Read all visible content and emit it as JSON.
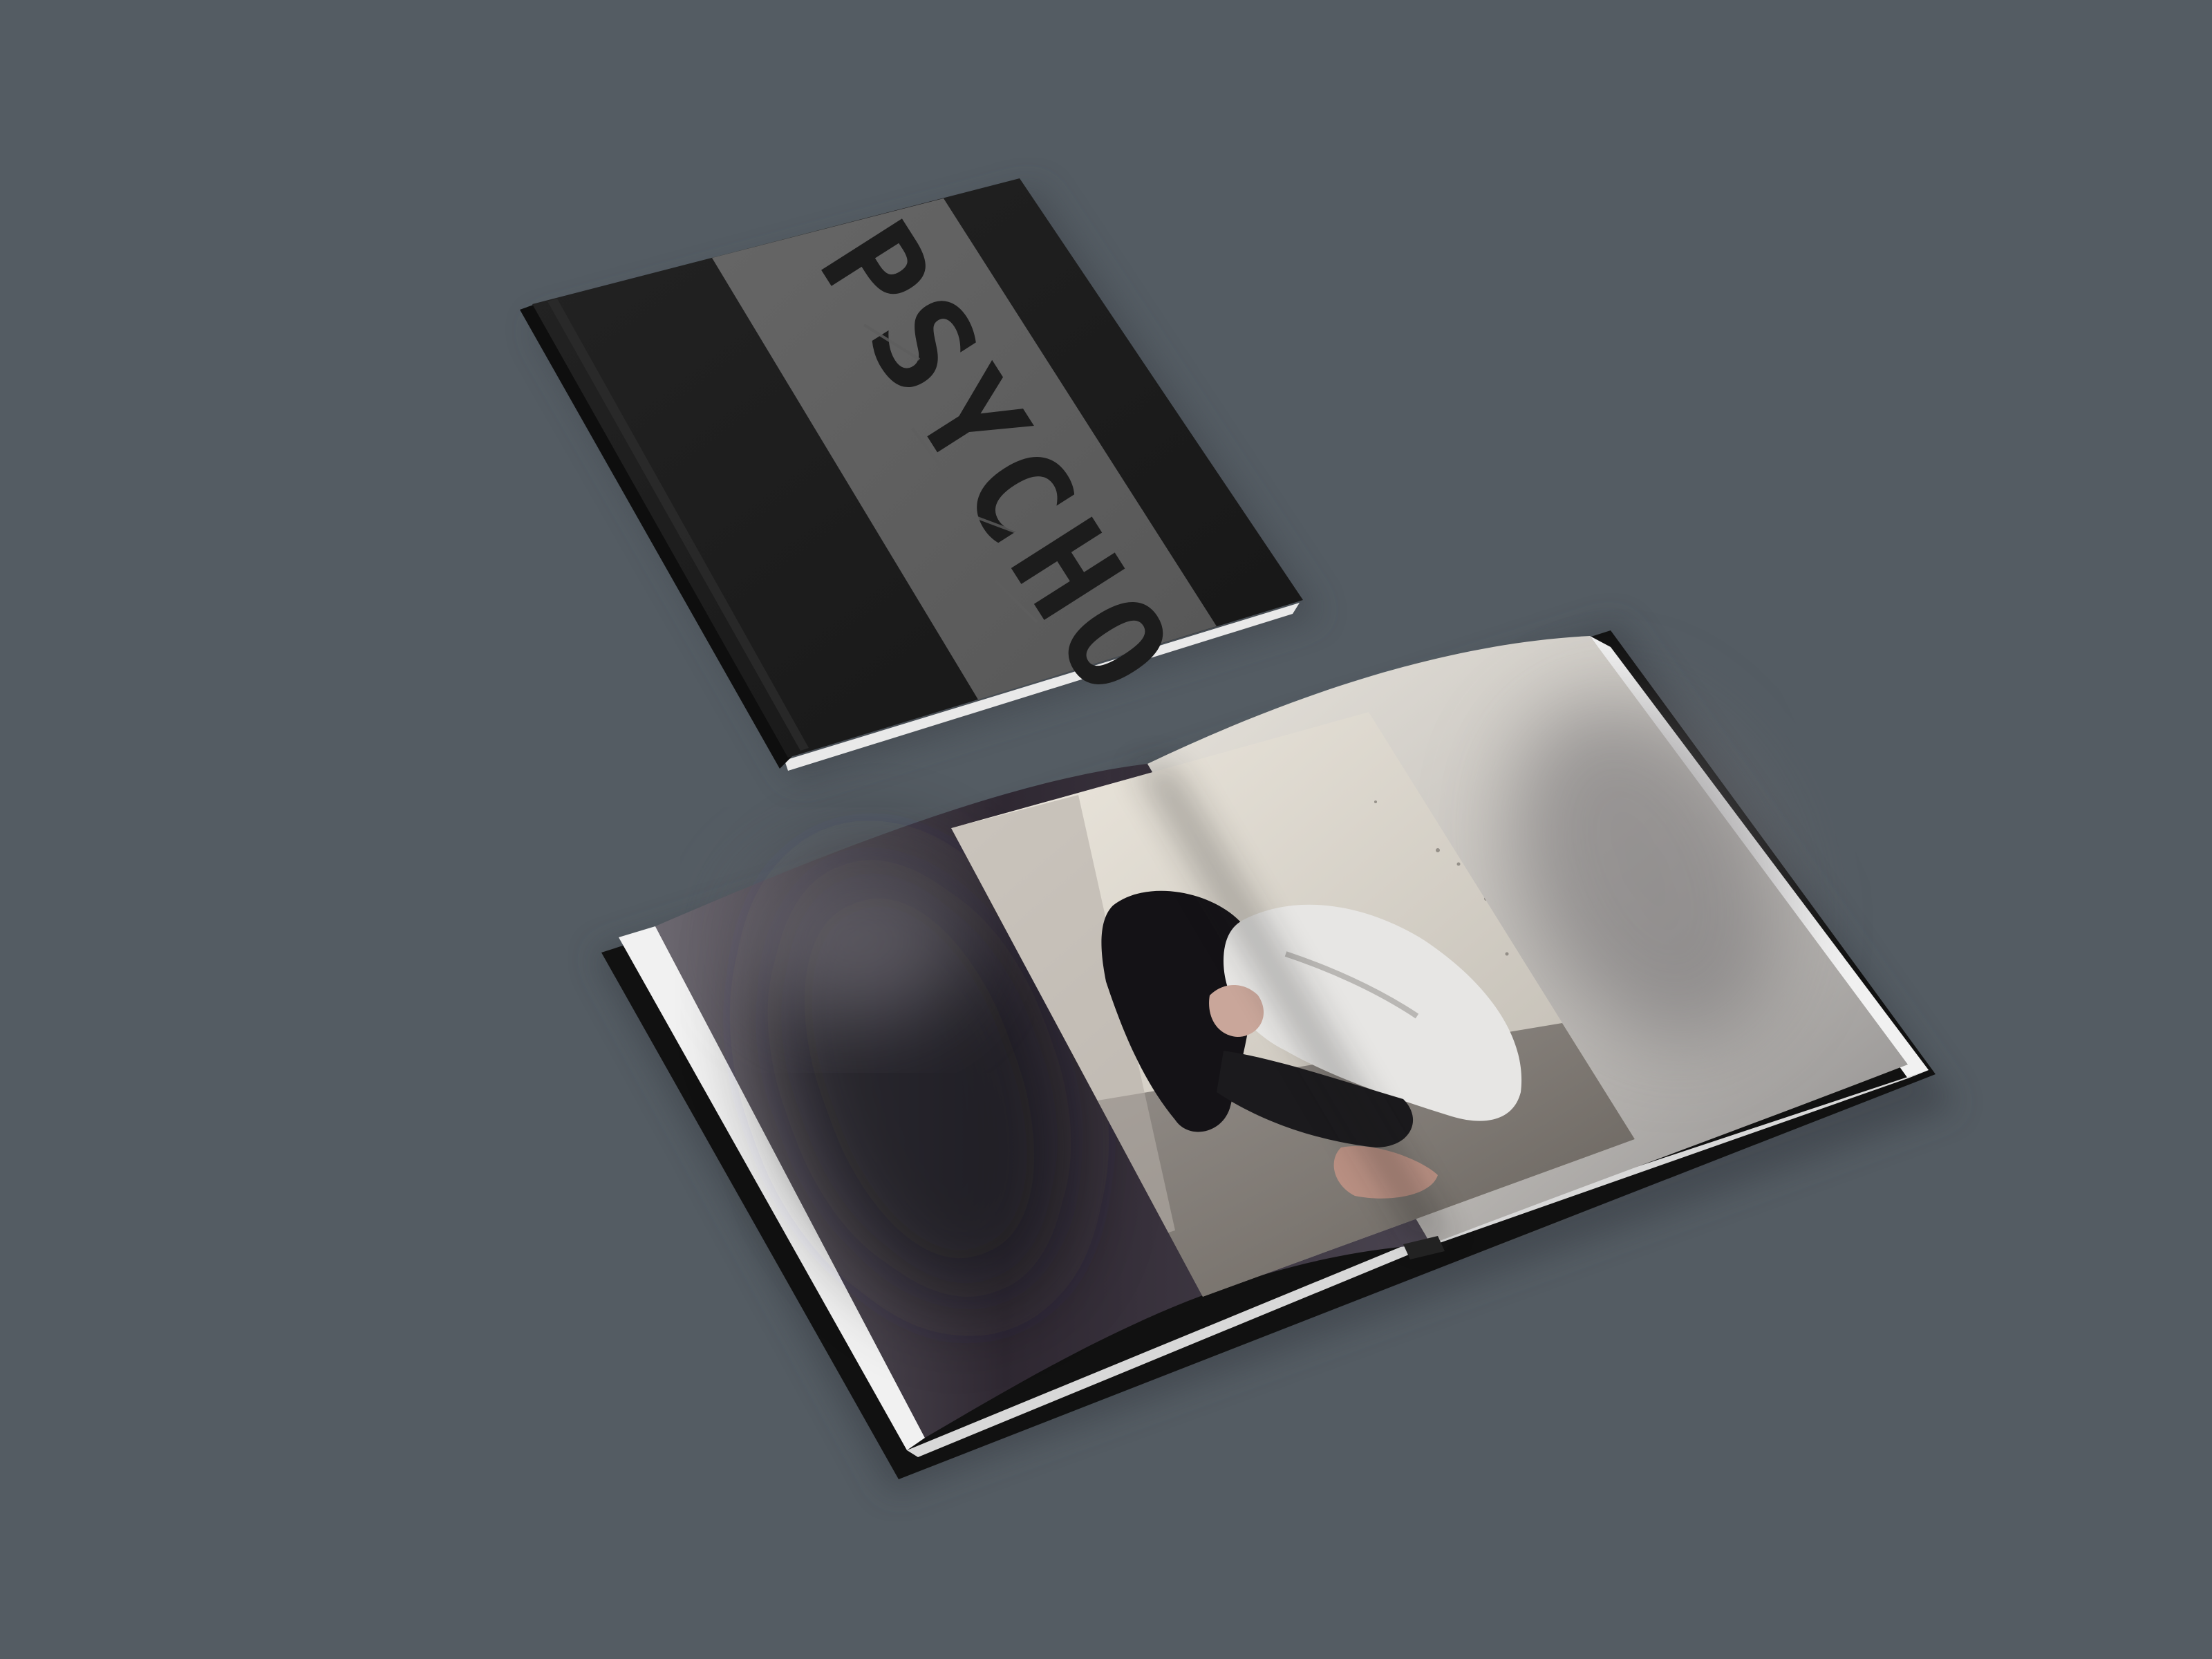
{
  "closed_book": {
    "cover_title": "PSYCHO",
    "colors": {
      "cover": "#1c1c1c",
      "band": "#5e5e5e",
      "title": "#1c1c1c"
    }
  },
  "open_book": {
    "photo_subject": "person-crouching-against-wall-photo",
    "colors": {
      "cover": "#121212",
      "page": "#d9d6d0",
      "shadow": "#2a2430"
    }
  },
  "background": {
    "color": "#545c63"
  }
}
